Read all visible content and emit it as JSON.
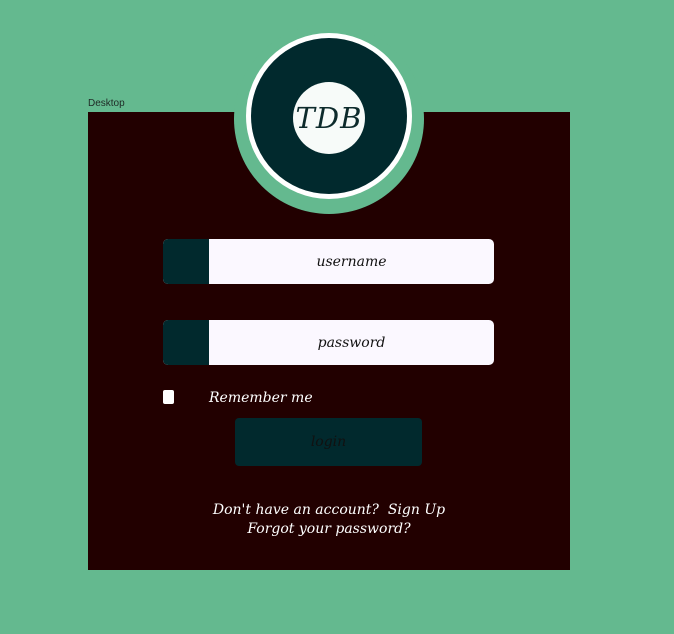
{
  "frame": {
    "label": "Desktop"
  },
  "logo": {
    "text": "TDB"
  },
  "form": {
    "username_placeholder": "username",
    "password_placeholder": "password",
    "remember_label": "Remember me",
    "login_label": "login"
  },
  "footer": {
    "signup_prompt": "Don't have an account?",
    "signup_link": "Sign Up",
    "forgot_link": "Forgot your password?"
  },
  "colors": {
    "background": "#64b98f",
    "panel": "#220000",
    "accent": "#01292d",
    "field": "#fbf8ff"
  }
}
